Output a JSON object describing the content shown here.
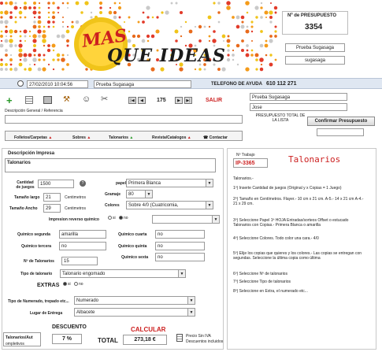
{
  "header": {
    "logo_text_1": "MAS",
    "logo_text_2": "QUE IDEAS",
    "presupuesto_label": "Nº de PRESUPUESTO",
    "presupuesto_number": "3354",
    "client_name": "Prueba Sugasaga",
    "client_user": "sugasaga"
  },
  "infobar": {
    "datetime": "27/02/2010 10:04:56",
    "client": "Prueba Sugasaga",
    "help_label": "TELEFONO DE AYUDA",
    "help_phone": "610 112 271"
  },
  "toolbar": {
    "record_number": "175",
    "exit_label": "SALIR",
    "contact_company": "Prueba Sugasaga",
    "contact_name": "Jose",
    "description_label": "Descripción General / Referencia",
    "total_label": "PRESUPUESTO TOTAL DE LA LISTA",
    "confirm_button": "Confirmar Presupuesto"
  },
  "nav": {
    "tabs": [
      "Folletos/Carpetas",
      "Sobres",
      "Talonarios",
      "Revista/Catalogos",
      "Contactar"
    ]
  },
  "form": {
    "description_title": "Descripción Impresa",
    "description_value": "Talonarios",
    "cantidad_label": "Cantidad de juegos",
    "cantidad_value": "1500",
    "papel_label": "papel",
    "papel_value": "Primera Blanca",
    "gramaje_label": "Gramaje",
    "gramaje_value": "80",
    "tamano_largo_label": "Tamaño largo",
    "tamano_largo_value": "21",
    "tamano_ancho_label": "Tamaño Ancho",
    "tamano_ancho_value": "29",
    "unit": "Centimetros",
    "colores_label": "Colores",
    "colores_value": "Sobre 4/0 (Cuatricomia,",
    "reverso_label": "Impresion reverso químico",
    "si_label": "si",
    "no_label": "no",
    "quimico_segunda_label": "Químico segunda",
    "quimico_segunda_value": "amarilla",
    "quimico_cuarta_label": "Químico cuarta",
    "quimico_cuarta_value": "no",
    "quimico_tercera_label": "Químico tercera",
    "quimico_tercera_value": "no",
    "quimico_quinta_label": "Químico quinta",
    "quimico_quinta_value": "no",
    "quimico_sexta_label": "Químico sexta",
    "quimico_sexta_value": "no",
    "num_talonarios_label": "Nº de Talonarios",
    "num_talonarios_value": "15",
    "tipo_talonario_label": "Tipo de talonario",
    "tipo_talonario_value": "Talonario engomado",
    "extras_label": "EXTRAS",
    "tipo_numerado_label": "Tipo de Numerado, trepado etc...",
    "tipo_numerado_value": "Numerado",
    "lugar_entrega_label": "Lugar de Entrega",
    "lugar_entrega_value": "Albacete"
  },
  "footer": {
    "product_code": "Talonarios/Aut",
    "product_sub": "ompletivos",
    "descuento_label": "DESCUENTO",
    "descuento_value": "7 %",
    "calcular_label": "CALCULAR",
    "total_label": "TOTAL",
    "total_value": "273,18 €",
    "iva_note_1": "Precio Sin IVA",
    "iva_note_2": "Descuentos incluidos"
  },
  "right": {
    "trabajo_label": "Nº Trabajo",
    "trabajo_value": "IP-3365",
    "product_title": "Talonarios",
    "intro": "Talonarios.-",
    "steps": [
      "1º) Inserte Cantidad de juegos (Original y  x Copias = 1 Juego)",
      "2º) Tamaño en Centímetros. Flayer.- 10 cm x 21 cm. A-5.- 14 x 21 cm A-4.- 21 x 29 cm.",
      "3º) Seleccione Papel 1ª HOJA Entradas/sorteos Offset o estucado Talonarios con Copias.- Primera Blanca o amarilla",
      "4º) Seleccione Colores. Todo color una cara.- 4/0",
      "5º) Elije los copias que quieres y los colores.- Las copias se entregan con segundas. Seleccione la última copia como última",
      "6º) Seleccione Nº de talonarios",
      "7º) Seleccione Tipo de talonarios",
      "8º) Seleccione en Extra, el numerado etc..."
    ]
  },
  "colors": {
    "brand_red": "#cc1f1f",
    "brand_yellow": "#f0c419",
    "banner_blue": "#dfe7f2"
  }
}
